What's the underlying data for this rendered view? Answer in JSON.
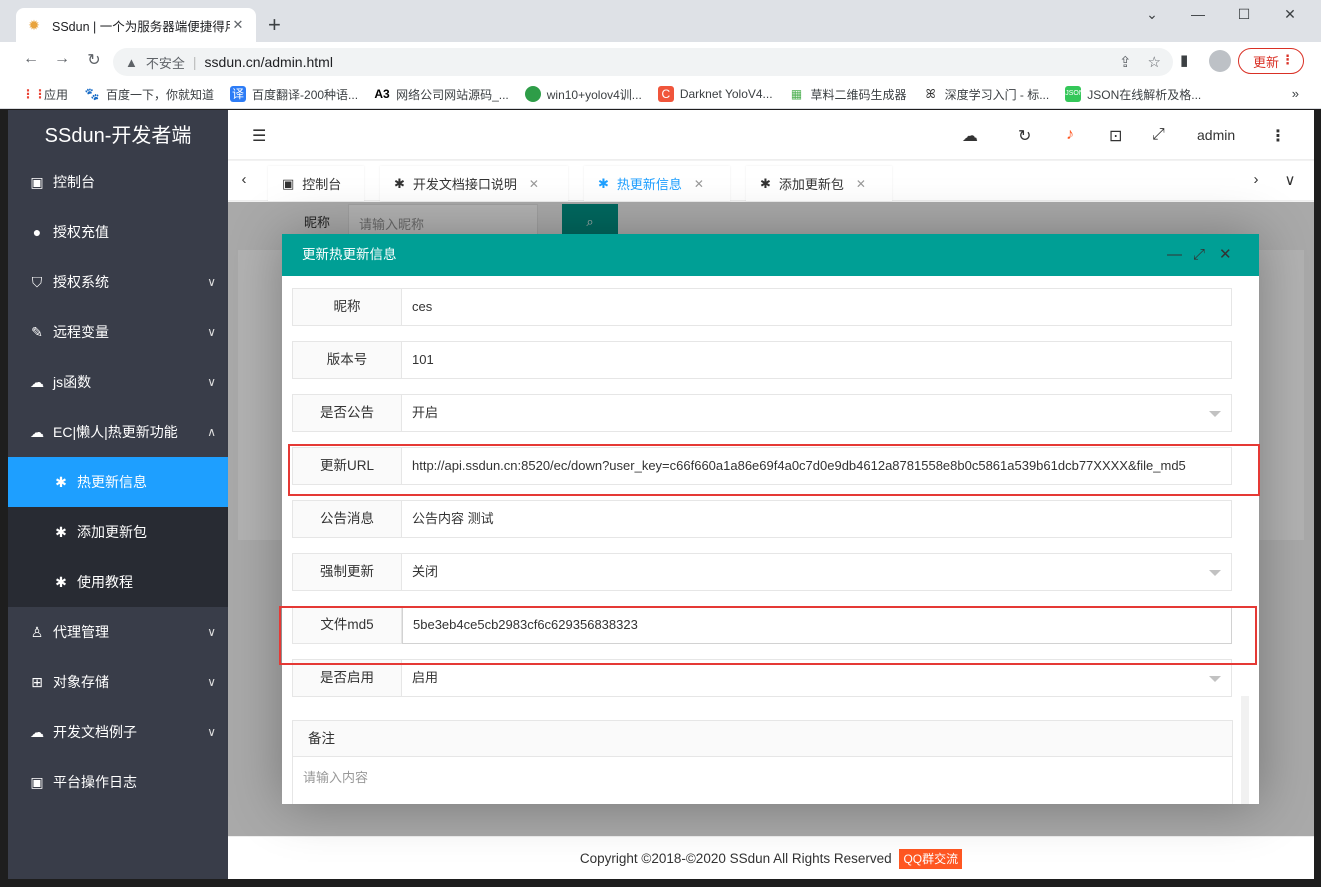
{
  "browser": {
    "tab_title": "SSdun | 一个为服务器端便捷得用",
    "insecure_label": "不安全",
    "url": "ssdun.cn/admin.html",
    "update_label": "更新",
    "bookmarks": [
      "应用",
      "百度一下，你就知道",
      "百度翻译-200种语...",
      "网络公司网站源码_...",
      "win10+yolov4训...",
      "Darknet YoloV4...",
      "草料二维码生成器",
      "深度学习入门 - 标...",
      "JSON在线解析及格..."
    ],
    "bookmark_more": "»"
  },
  "app": {
    "logo": "SSdun-开发者端",
    "user": "admin",
    "menu": [
      {
        "label": "控制台",
        "icon": "monitor-icon"
      },
      {
        "label": "授权充值",
        "icon": "bulb-icon"
      },
      {
        "label": "授权系统",
        "icon": "shield-icon",
        "arrow": "down"
      },
      {
        "label": "远程变量",
        "icon": "pen-icon",
        "arrow": "down"
      },
      {
        "label": "js函数",
        "icon": "cloud-icon",
        "arrow": "down"
      },
      {
        "label": "EC|懒人|热更新功能",
        "icon": "cloud-icon",
        "arrow": "up"
      }
    ],
    "submenu": [
      "热更新信息",
      "添加更新包",
      "使用教程"
    ],
    "menu_after": [
      {
        "label": "代理管理",
        "icon": "user-icon"
      },
      {
        "label": "对象存储",
        "icon": "grid-icon"
      },
      {
        "label": "开发文档例子",
        "icon": "cloud-icon"
      },
      {
        "label": "平台操作日志",
        "icon": "monitor-icon"
      }
    ],
    "tabs": [
      "控制台",
      "开发文档接口说明",
      "热更新信息",
      "添加更新包"
    ],
    "bg_search_label": "昵称",
    "bg_search_placeholder": "请输入昵称",
    "footer_text": "Copyright ©2018-©2020 SSdun All Rights Reserved",
    "footer_badge": "QQ群交流"
  },
  "modal": {
    "title": "更新热更新信息",
    "fields": [
      {
        "label": "昵称",
        "value": "ces"
      },
      {
        "label": "版本号",
        "value": "101"
      },
      {
        "label": "是否公告",
        "value": "开启",
        "select": true
      },
      {
        "label": "更新URL",
        "value": "http://api.ssdun.cn:8520/ec/down?user_key=c66f660a1a86e69f4a0c7d0e9db4612a8781558e8b0c5861a539b61dcb77XXXX&file_md5"
      },
      {
        "label": "公告消息",
        "value": "公告内容 测试"
      },
      {
        "label": "强制更新",
        "value": "关闭",
        "select": true
      },
      {
        "label": "文件md5",
        "value": "5be3eb4ce5cb2983cf6c629356838323"
      },
      {
        "label": "是否启用",
        "value": "启用",
        "select": true
      }
    ],
    "remark_label": "备注",
    "remark_placeholder": "请输入内容"
  }
}
